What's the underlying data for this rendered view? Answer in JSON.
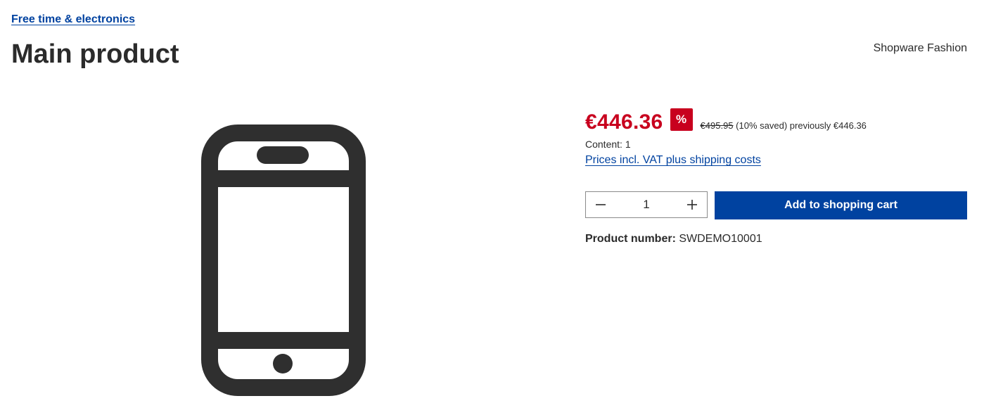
{
  "breadcrumb": {
    "category": "Free time & electronics"
  },
  "product": {
    "title": "Main product",
    "manufacturer": "Shopware Fashion",
    "image_icon": "smartphone-icon",
    "price": "€446.36",
    "discount_badge": "%",
    "list_price": "€495.95",
    "saved_text": "(10% saved)",
    "previously_text": "previously €446.36",
    "content_text": "Content: 1",
    "tax_link": "Prices incl. VAT plus shipping costs",
    "product_number_label": "Product number:",
    "product_number_value": "SWDEMO10001"
  },
  "buy_box": {
    "quantity": "1",
    "minus_icon": "minus-icon",
    "plus_icon": "plus-icon",
    "add_to_cart_label": "Add to shopping cart"
  },
  "colors": {
    "accent_blue": "#0042a0",
    "price_red": "#c8001e",
    "text": "#2b2b2b"
  }
}
